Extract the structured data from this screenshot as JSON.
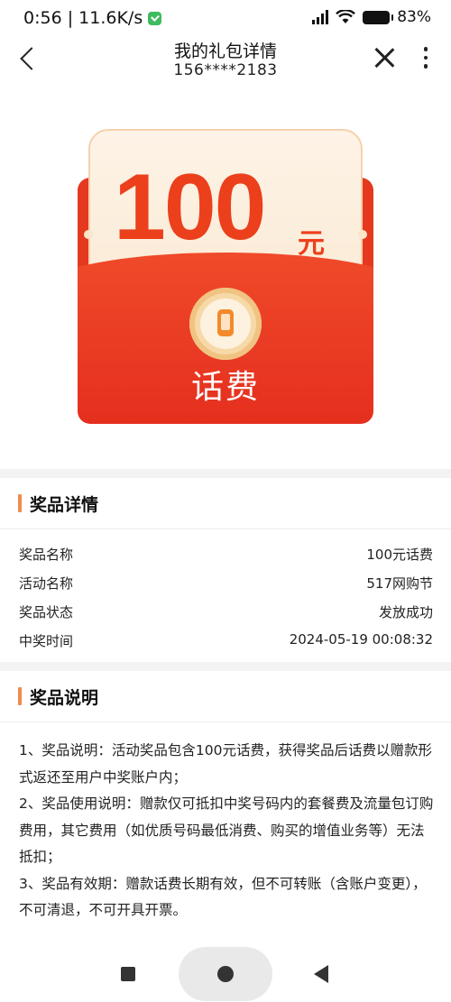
{
  "status_bar": {
    "time_speed": "0:56 | 11.6K/s",
    "battery": "83%"
  },
  "header": {
    "title": "我的礼包详情",
    "phone": "156****2183"
  },
  "prize_card": {
    "amount": "100",
    "unit": "元",
    "type_label": "话费"
  },
  "prize_details": {
    "heading": "奖品详情",
    "rows": [
      {
        "label": "奖品名称",
        "value": "100元话费"
      },
      {
        "label": "活动名称",
        "value": "517网购节"
      },
      {
        "label": "奖品状态",
        "value": "发放成功"
      },
      {
        "label": "中奖时间",
        "value": "2024-05-19 00:08:32"
      }
    ]
  },
  "prize_notes": {
    "heading": "奖品说明",
    "items": [
      "1、奖品说明：活动奖品包含100元话费，获得奖品后话费以赠款形式返还至用户中奖账户内；",
      "2、奖品使用说明：赠款仅可抵扣中奖号码内的套餐费及流量包订购费用，其它费用（如优质号码最低消费、购买的增值业务等）无法抵扣；",
      "3、奖品有效期：赠款话费长期有效，但不可转账（含账户变更），不可清退，不可开具开票。"
    ]
  },
  "icons": {
    "back": "back-arrow-icon",
    "close": "close-icon",
    "more": "more-vertical-icon",
    "prize": "phone-icon"
  },
  "colors": {
    "accent": "#f28b4b",
    "envelope_red": "#e5391f",
    "amount_red": "#ec3f1b"
  }
}
